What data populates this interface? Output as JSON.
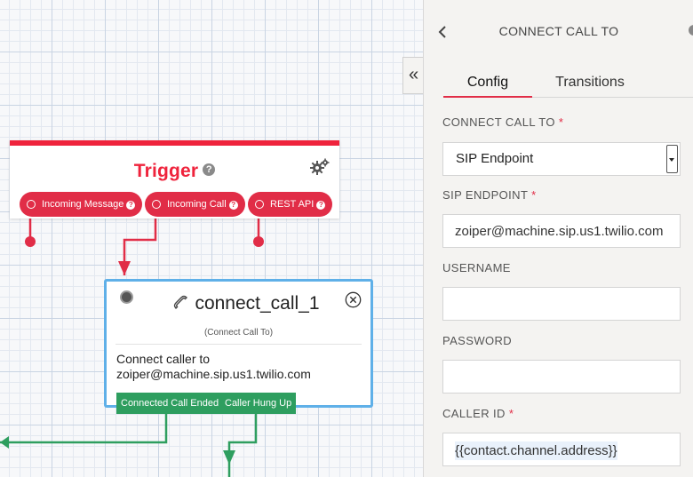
{
  "trigger": {
    "title": "Trigger",
    "help": "?",
    "settings_icon": "gears-icon",
    "pills": [
      {
        "label": "Incoming Message",
        "help": "?"
      },
      {
        "label": "Incoming Call",
        "help": "?"
      },
      {
        "label": "REST API",
        "help": "?"
      }
    ]
  },
  "widget": {
    "icon": "phone-icon",
    "title": "connect_call_1",
    "type_label": "(Connect Call To)",
    "description_line1": "Connect caller to",
    "description_line2": "zoiper@machine.sip.us1.twilio.com",
    "exits": [
      "Connected Call Ended",
      "Caller Hung Up"
    ]
  },
  "colors": {
    "trigger_red": "#ef233c",
    "pill_red": "#e12d47",
    "widget_border": "#5fb0e8",
    "wire_green": "#2e9e5f"
  },
  "panel": {
    "collapse_label": "«",
    "title": "CONNECT CALL TO",
    "tabs": [
      "Config",
      "Transitions"
    ],
    "active_tab": "Config",
    "fields": {
      "connect_call_to": {
        "label": "CONNECT CALL TO",
        "required": "*",
        "value": "SIP Endpoint"
      },
      "sip_endpoint": {
        "label": "SIP ENDPOINT",
        "required": "*",
        "value": "zoiper@machine.sip.us1.twilio.com"
      },
      "username": {
        "label": "USERNAME",
        "value": ""
      },
      "password": {
        "label": "PASSWORD",
        "value": ""
      },
      "caller_id": {
        "label": "CALLER ID",
        "required": "*",
        "value": "{{contact.channel.address}}"
      }
    }
  }
}
